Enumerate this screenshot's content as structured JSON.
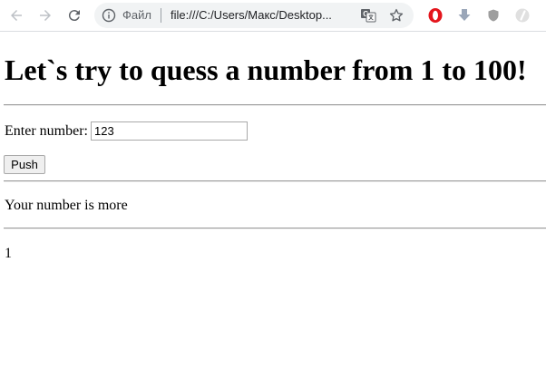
{
  "browser": {
    "site_label": "Файл",
    "url": "file:///C:/Users/Макс/Desktop...",
    "icons": [
      "back-arrow-icon",
      "forward-arrow-icon",
      "reload-icon",
      "info-icon",
      "translate-icon",
      "star-icon",
      "opera-icon",
      "download-icon",
      "shield-icon",
      "extension-icon"
    ]
  },
  "page": {
    "title": "Let`s try to quess a number from 1 to 100!",
    "input_label": "Enter number:",
    "input_value": "123",
    "push_label": "Push",
    "result_text": "Your number is more",
    "counter": "1"
  },
  "colors": {
    "opera_red": "#e4151c",
    "rule": "#9a9a9a"
  }
}
